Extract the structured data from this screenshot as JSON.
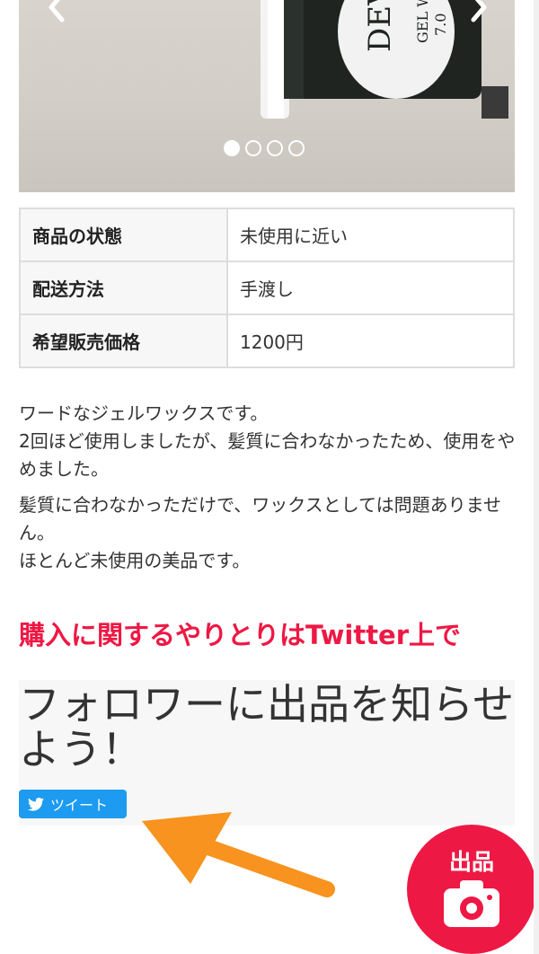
{
  "carousel": {
    "prev_icon": "chevron-left-icon",
    "next_icon": "chevron-right-icon",
    "jar_label_brand": "DEVI",
    "jar_label_sub": "GEL WAX",
    "jar_label_num": "7.0",
    "slide_count": 4,
    "active_slide": 1
  },
  "details": {
    "rows": [
      {
        "key": "商品の状態",
        "value": "未使用に近い"
      },
      {
        "key": "配送方法",
        "value": "手渡し"
      },
      {
        "key": "希望販売価格",
        "value": "1200円"
      }
    ]
  },
  "description": {
    "p1_line1": "ワードなジェルワックスです。",
    "p1_line2": "2回ほど使用しましたが、髪質に合わなかったため、使用をやめました。",
    "p2_line1": "髪質に合わなかっただけで、ワックスとしては問題ありません。",
    "p2_line2": "ほとんど未使用の美品です。"
  },
  "notice": "購入に関するやりとりはTwitter上で",
  "share": {
    "title": "フォロワーに出品を知らせよう！",
    "tweet_label": "ツイート",
    "tweet_icon": "twitter-bird-icon"
  },
  "fab": {
    "label": "出品",
    "icon": "camera-icon"
  },
  "colors": {
    "accent": "#ee1844",
    "twitter": "#1d9bf0",
    "annotation": "#f7931e"
  }
}
